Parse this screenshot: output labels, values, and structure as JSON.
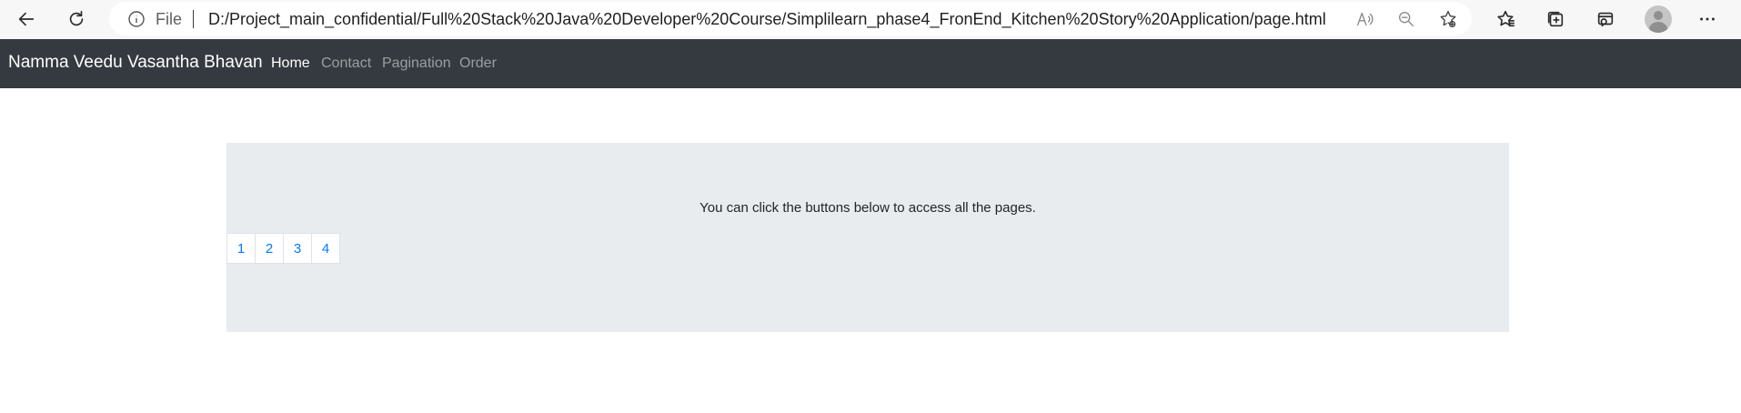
{
  "browser": {
    "file_label": "File",
    "url": "D:/Project_main_confidential/Full%20Stack%20Java%20Developer%20Course/Simplilearn_phase4_FronEnd_Kitchen%20Story%20Application/page.html",
    "icons": [
      "back-arrow-icon",
      "refresh-icon",
      "info-icon",
      "read-aloud-icon",
      "zoom-out-icon",
      "add-favorite-icon",
      "favorites-icon",
      "collections-icon",
      "browser-essentials-icon",
      "profile-avatar",
      "more-menu-icon"
    ]
  },
  "navbar": {
    "brand": "Namma Veedu Vasantha Bhavan",
    "links": [
      {
        "label": "Home",
        "active": true
      },
      {
        "label": "Contact",
        "active": false
      },
      {
        "label": "Pagination",
        "active": false
      },
      {
        "label": "Order",
        "active": false
      }
    ]
  },
  "jumbotron": {
    "text": "You can click the buttons below to access all the pages."
  },
  "pagination": {
    "pages": [
      "1",
      "2",
      "3",
      "4"
    ]
  },
  "colors": {
    "navbar_bg": "#343a40",
    "jumbotron_bg": "#e9ecef",
    "link_blue": "#007bff"
  }
}
